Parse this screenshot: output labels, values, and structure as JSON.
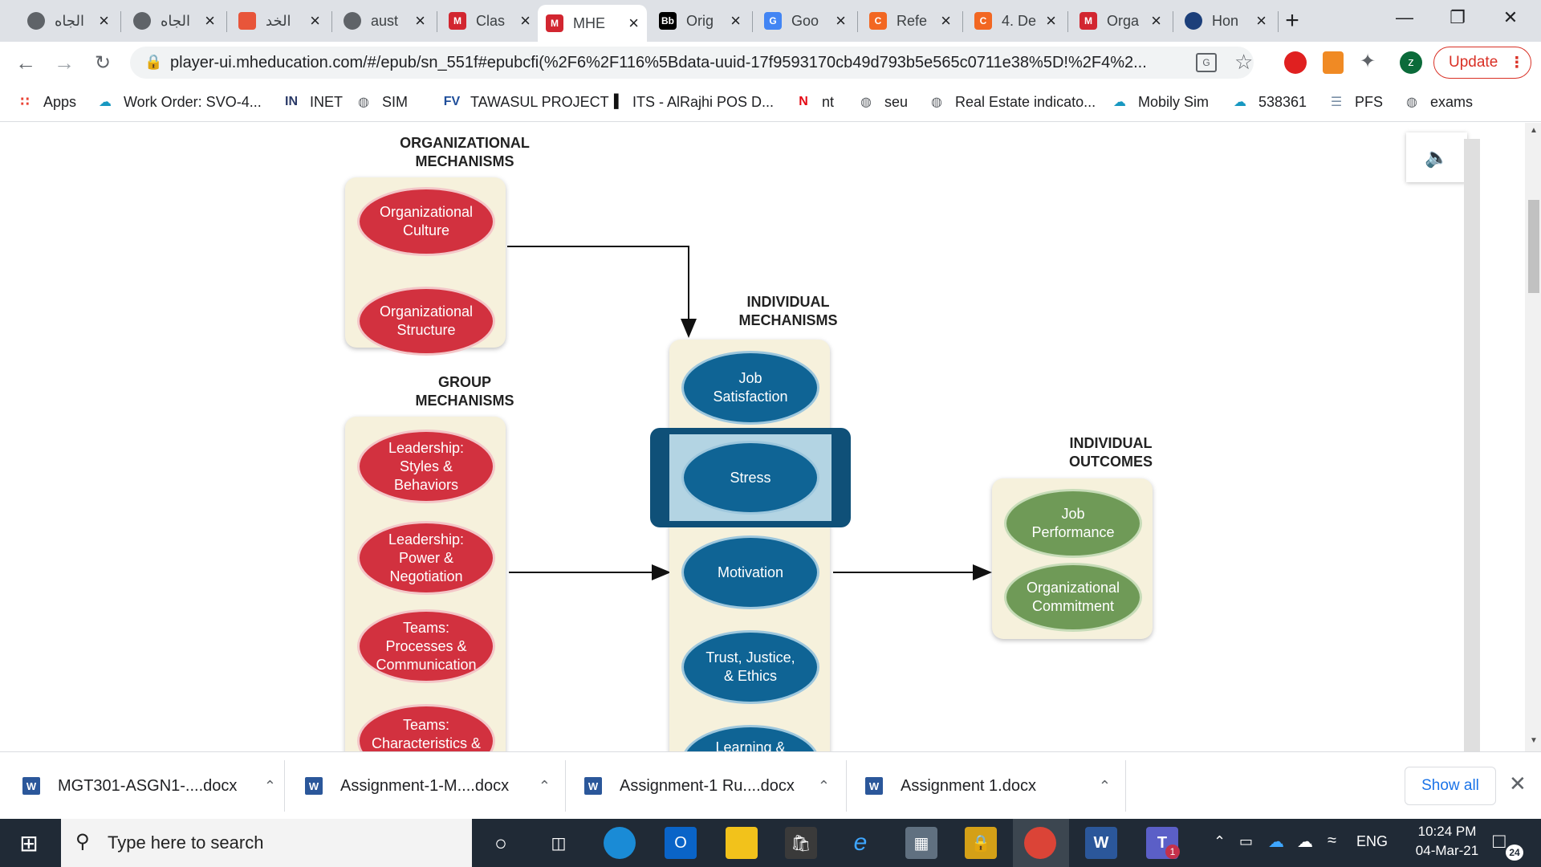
{
  "browser": {
    "tabs": [
      {
        "title": "الجاه",
        "favicon": "globe-icon"
      },
      {
        "title": "الجاه",
        "favicon": "globe-icon"
      },
      {
        "title": "الخد",
        "favicon": "site-icon"
      },
      {
        "title": "aust",
        "favicon": "globe-icon"
      },
      {
        "title": "Clas",
        "favicon": "mcgraw-hill-icon"
      },
      {
        "title": "MHE",
        "favicon": "mhe-icon"
      },
      {
        "title": "Orig",
        "favicon": "blackboard-icon"
      },
      {
        "title": "Goo",
        "favicon": "google-translate-icon"
      },
      {
        "title": "Refe",
        "favicon": "c-icon"
      },
      {
        "title": "4. De",
        "favicon": "c-icon"
      },
      {
        "title": "Orga",
        "favicon": "mhe-icon"
      },
      {
        "title": "Hon",
        "favicon": "hub-icon"
      }
    ],
    "new_tab_symbol": "+",
    "url": "player-ui.mheducation.com/#/epub/sn_551f#epubcfi(%2F6%2F116%5Bdata-uuid-17f9593170cb49d793b5e565c0711e38%5D!%2F4%2...",
    "update_label": "Update",
    "profile_initial": "z",
    "bookmarks": [
      {
        "label": "Apps",
        "icon": "apps-grid-icon"
      },
      {
        "label": "Work Order: SVO-4...",
        "icon": "salesforce-icon"
      },
      {
        "label": "INET",
        "icon": "inet-icon"
      },
      {
        "label": "SIM",
        "icon": "globe-icon"
      },
      {
        "label": "TAWASUL PROJECT",
        "icon": "fv-icon"
      },
      {
        "label": "ITS - AlRajhi POS D...",
        "icon": "bars-icon"
      },
      {
        "label": "nt",
        "icon": "n-icon"
      },
      {
        "label": "seu",
        "icon": "globe-icon"
      },
      {
        "label": "Real Estate indicato...",
        "icon": "globe-icon"
      },
      {
        "label": "Mobily Sim",
        "icon": "cloud-icon"
      },
      {
        "label": "538361",
        "icon": "salesforce-icon"
      },
      {
        "label": "PFS",
        "icon": "doc-icon"
      },
      {
        "label": "exams",
        "icon": "globe-icon"
      }
    ]
  },
  "diagram": {
    "org_heading": "ORGANIZATIONAL\nMECHANISMS",
    "org_items": [
      "Organizational\nCulture",
      "Organizational\nStructure"
    ],
    "group_heading": "GROUP\nMECHANISMS",
    "group_items": [
      "Leadership:\nStyles &\nBehaviors",
      "Leadership:\nPower &\nNegotiation",
      "Teams:\nProcesses &\nCommunication",
      "Teams:\nCharacteristics &"
    ],
    "ind_heading": "INDIVIDUAL\nMECHANISMS",
    "ind_items": [
      "Job\nSatisfaction",
      "Stress",
      "Motivation",
      "Trust, Justice,\n& Ethics",
      "Learning &"
    ],
    "out_heading": "INDIVIDUAL\nOUTCOMES",
    "out_items": [
      "Job\nPerformance",
      "Organizational\nCommitment"
    ],
    "colors": {
      "red": "#d2313f",
      "blue": "#0f6495",
      "green": "#6f9a57",
      "highlight": "#0f5078"
    }
  },
  "downloads": {
    "items": [
      "MGT301-ASGN1-....docx",
      "Assignment-1-M....docx",
      "Assignment-1 Ru....docx",
      "Assignment 1.docx"
    ],
    "show_all": "Show all"
  },
  "taskbar": {
    "search_placeholder": "Type here to search",
    "time": "10:24 PM",
    "date": "04-Mar-21",
    "lang": "ENG",
    "notif_count": "24",
    "teams_badge": "1"
  }
}
